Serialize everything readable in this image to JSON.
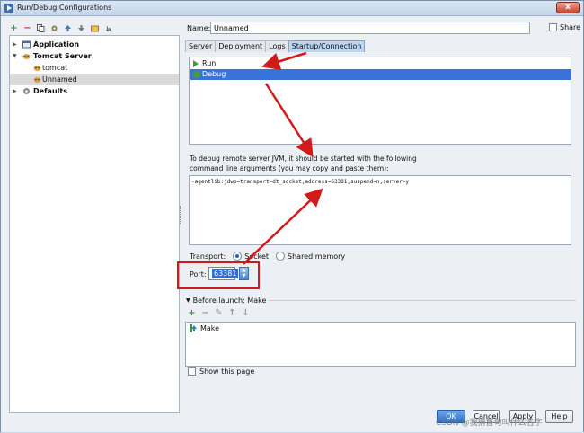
{
  "window": {
    "title": "Run/Debug Configurations",
    "close": "x"
  },
  "left_toolbar": [
    "+",
    "−",
    "copy",
    "edit",
    "up",
    "down",
    "folder",
    "sort"
  ],
  "tree": [
    {
      "label": "Application",
      "level": 0,
      "expanded": false
    },
    {
      "label": "Tomcat Server",
      "level": 0,
      "expanded": true
    },
    {
      "label": "tomcat",
      "level": 1
    },
    {
      "label": "Unnamed",
      "level": 1,
      "selected": true
    },
    {
      "label": "Defaults",
      "level": 0,
      "expanded": false
    }
  ],
  "name": {
    "label": "Name:",
    "value": "Unnamed"
  },
  "share": {
    "label": "Share",
    "checked": false
  },
  "tabs": [
    {
      "label": "Server"
    },
    {
      "label": "Deployment"
    },
    {
      "label": "Logs"
    },
    {
      "label": "Startup/Connection",
      "active": true
    }
  ],
  "run_list": [
    {
      "label": "Run",
      "selected": false
    },
    {
      "label": "Debug",
      "selected": true
    }
  ],
  "info_text_line1": "To debug remote server JVM, it should be started with the following",
  "info_text_line2": "command line arguments (you may copy and paste them):",
  "command": "-agentlib:jdwp=transport=dt_socket,address=63381,suspend=n,server=y",
  "transport": {
    "label": "Transport:",
    "options": [
      "Socket",
      "Shared memory"
    ],
    "selected": "Socket"
  },
  "port": {
    "label": "Port:",
    "value": "63381"
  },
  "before_launch": {
    "label": "Before launch: Make",
    "items": [
      "Make"
    ]
  },
  "show_page": {
    "label": "Show this page",
    "checked": false
  },
  "buttons": {
    "ok": "OK",
    "cancel": "Cancel",
    "apply": "Apply",
    "help": "Help"
  },
  "watermark": "CSDN @我猜首句叫什么名字",
  "colors": {
    "accent": "#3874d8",
    "annotation": "#d11a1a"
  }
}
